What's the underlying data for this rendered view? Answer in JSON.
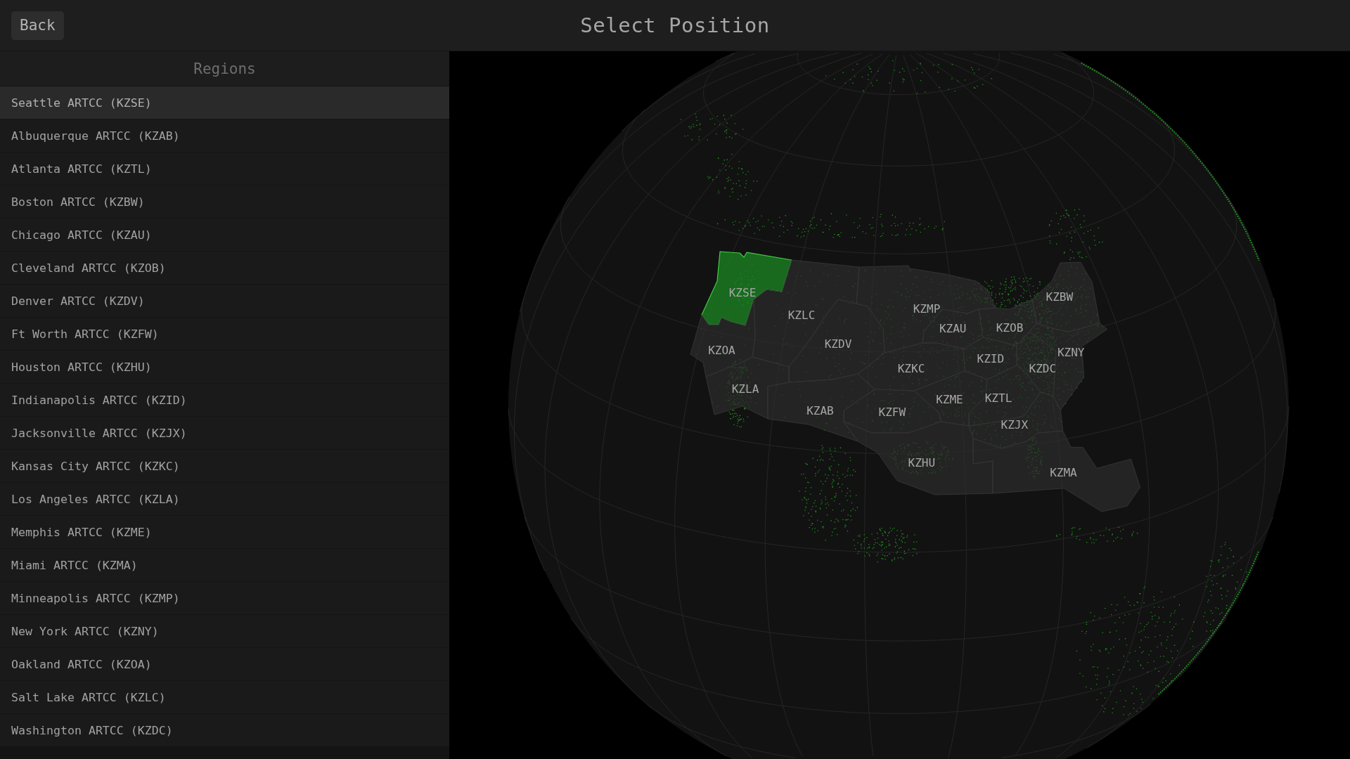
{
  "header": {
    "back_button": "Back",
    "title": "Select Position"
  },
  "sidebar": {
    "heading": "Regions",
    "items": [
      {
        "label": "Seattle ARTCC (KZSE)",
        "selected": true
      },
      {
        "label": "Albuquerque ARTCC (KZAB)",
        "selected": false
      },
      {
        "label": "Atlanta ARTCC (KZTL)",
        "selected": false
      },
      {
        "label": "Boston ARTCC (KZBW)",
        "selected": false
      },
      {
        "label": "Chicago ARTCC (KZAU)",
        "selected": false
      },
      {
        "label": "Cleveland ARTCC (KZOB)",
        "selected": false
      },
      {
        "label": "Denver ARTCC (KZDV)",
        "selected": false
      },
      {
        "label": "Ft Worth ARTCC (KZFW)",
        "selected": false
      },
      {
        "label": "Houston ARTCC (KZHU)",
        "selected": false
      },
      {
        "label": "Indianapolis ARTCC (KZID)",
        "selected": false
      },
      {
        "label": "Jacksonville ARTCC (KZJX)",
        "selected": false
      },
      {
        "label": "Kansas City ARTCC (KZKC)",
        "selected": false
      },
      {
        "label": "Los Angeles ARTCC (KZLA)",
        "selected": false
      },
      {
        "label": "Memphis ARTCC (KZME)",
        "selected": false
      },
      {
        "label": "Miami ARTCC (KZMA)",
        "selected": false
      },
      {
        "label": "Minneapolis ARTCC (KZMP)",
        "selected": false
      },
      {
        "label": "New York ARTCC (KZNY)",
        "selected": false
      },
      {
        "label": "Oakland ARTCC (KZOA)",
        "selected": false
      },
      {
        "label": "Salt Lake ARTCC (KZLC)",
        "selected": false
      },
      {
        "label": "Washington ARTCC (KZDC)",
        "selected": false
      }
    ]
  },
  "map": {
    "regions": [
      {
        "label": "KZSE",
        "selected": true
      },
      {
        "label": "KZBW",
        "selected": false
      },
      {
        "label": "KZMP",
        "selected": false
      },
      {
        "label": "KZLC",
        "selected": false
      },
      {
        "label": "KZAU",
        "selected": false
      },
      {
        "label": "KZOB",
        "selected": false
      },
      {
        "label": "KZDV",
        "selected": false
      },
      {
        "label": "KZOA",
        "selected": false
      },
      {
        "label": "KZNY",
        "selected": false
      },
      {
        "label": "KZID",
        "selected": false
      },
      {
        "label": "KZKC",
        "selected": false
      },
      {
        "label": "KZDC",
        "selected": false
      },
      {
        "label": "KZLA",
        "selected": false
      },
      {
        "label": "KZTL",
        "selected": false
      },
      {
        "label": "KZME",
        "selected": false
      },
      {
        "label": "KZAB",
        "selected": false
      },
      {
        "label": "KZFW",
        "selected": false
      },
      {
        "label": "KZJX",
        "selected": false
      },
      {
        "label": "KZHU",
        "selected": false
      },
      {
        "label": "KZMA",
        "selected": false
      }
    ]
  }
}
